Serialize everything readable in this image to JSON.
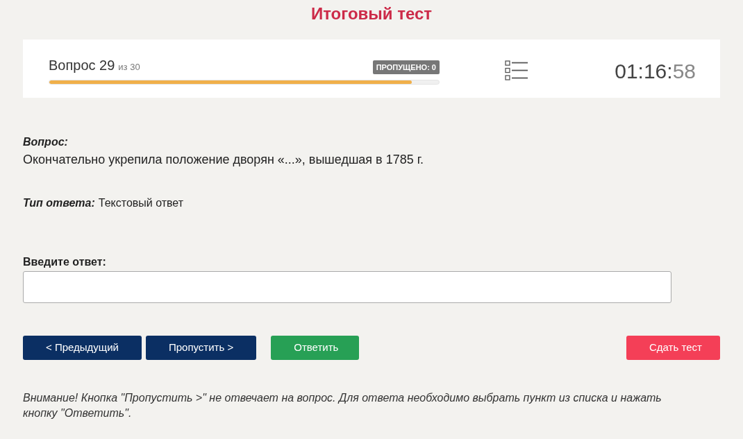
{
  "title": "Итоговый тест",
  "progress": {
    "label": "Вопрос 29",
    "total": "из 30",
    "skipped_badge": "ПРОПУЩЕНО: 0",
    "level": 0.93
  },
  "timer": {
    "hours_minutes": "01:16:",
    "seconds": "58"
  },
  "question": {
    "label": "Вопрос:",
    "text": "Окончательно укрепила положение дворян «...», вышедшая в 1785 г."
  },
  "answer_type": {
    "label": "Тип ответа:",
    "value": "Текстовый ответ"
  },
  "answer_field": {
    "label": "Введите ответ:"
  },
  "buttons": [
    {
      "label": "< Предыдущий",
      "kind": "nav"
    },
    {
      "label": "Пропустить >",
      "kind": "nav"
    },
    {
      "label": "Ответить",
      "kind": "answer"
    },
    {
      "label": "Сдать тест",
      "kind": "finish"
    }
  ],
  "notice": "Внимание! Кнопка \"Пропустить >\" не отвечает на вопрос. Для ответа необходимо выбрать пункт из списка и нажать кнопку \"Ответить\"."
}
